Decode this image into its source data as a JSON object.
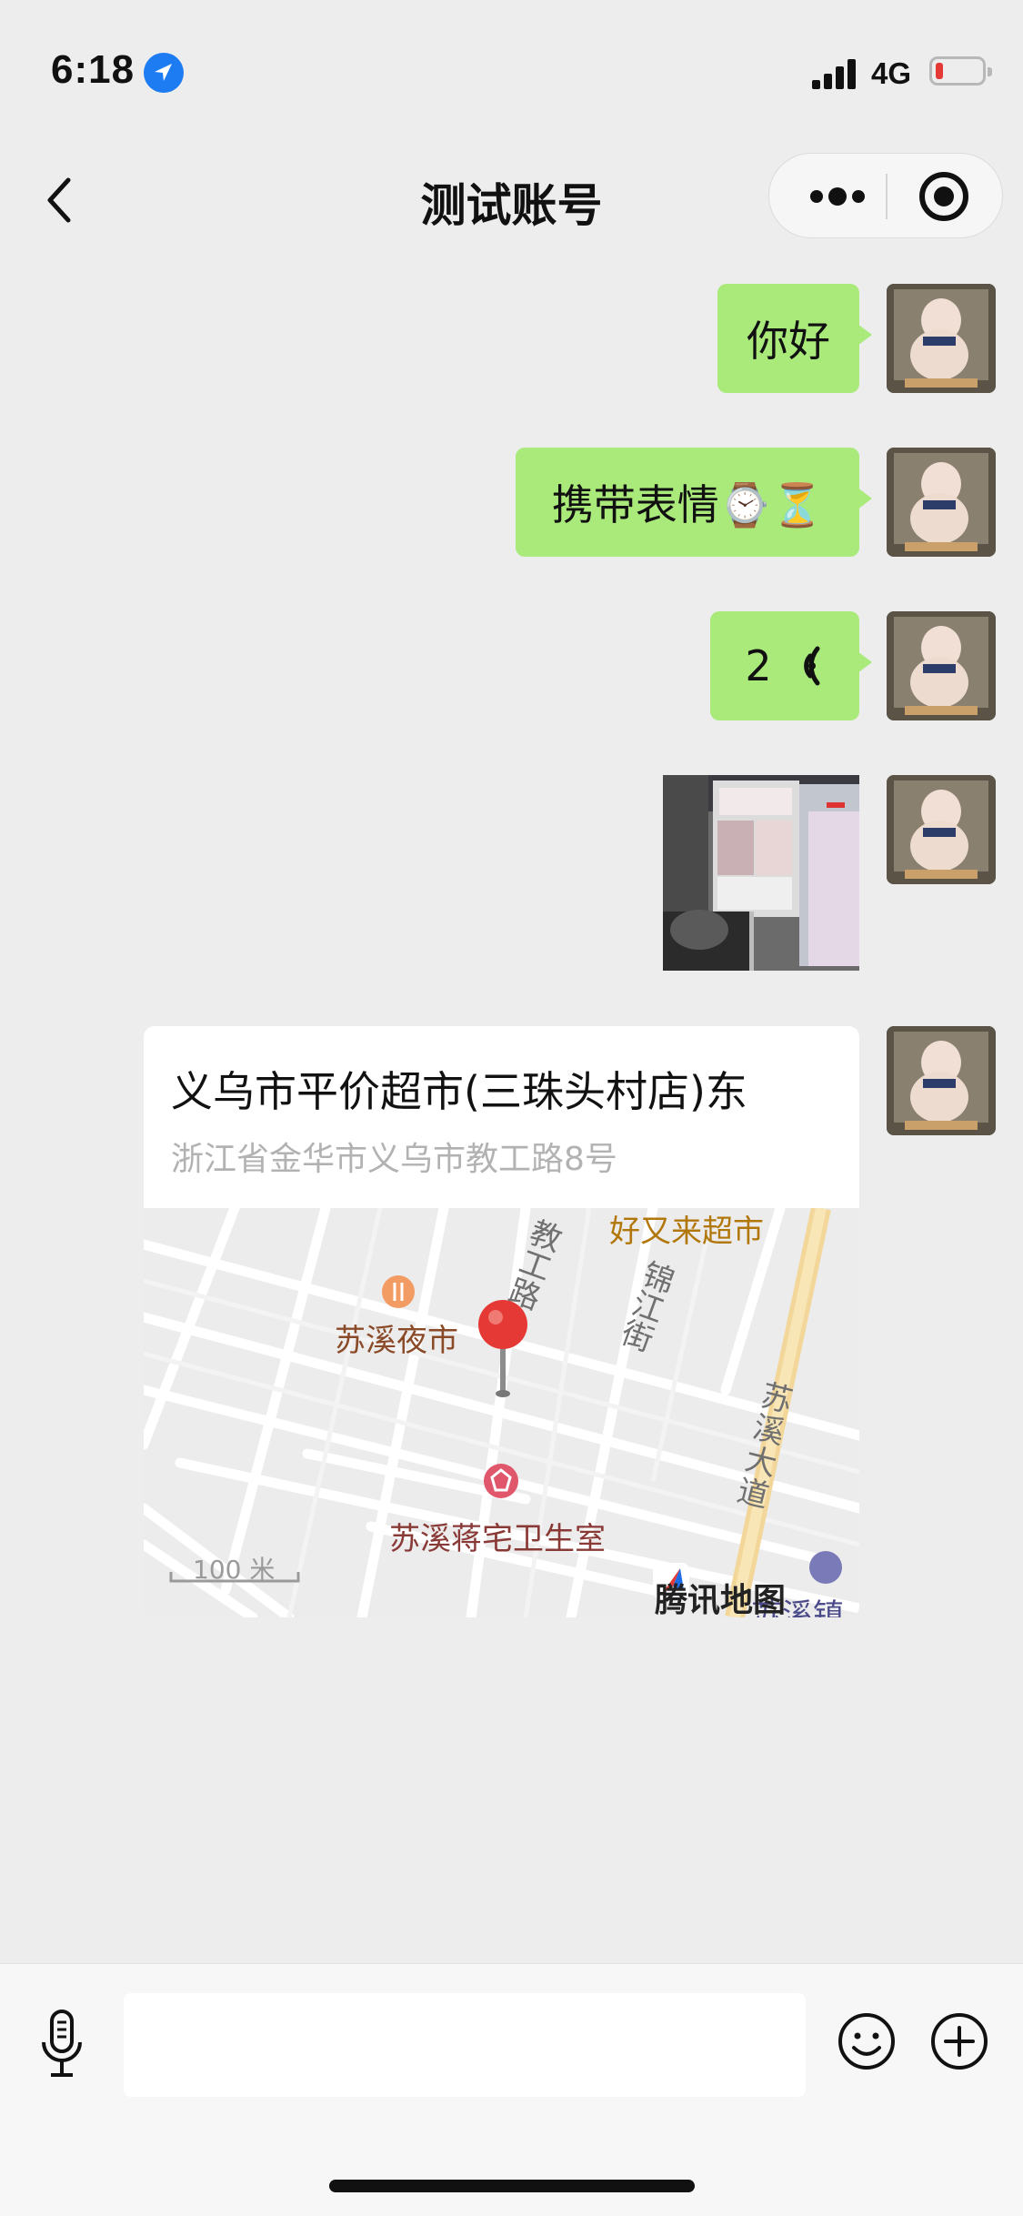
{
  "status_bar": {
    "time": "6:18",
    "network": "4G",
    "battery_level": 0.15
  },
  "nav": {
    "title": "测试账号"
  },
  "messages": [
    {
      "type": "text",
      "text": "你好"
    },
    {
      "type": "text",
      "text": "携带表情⌚⏳"
    },
    {
      "type": "voice",
      "duration": "2"
    },
    {
      "type": "image"
    },
    {
      "type": "location",
      "name": "义乌市平价超市(三珠头村店)东",
      "address": "浙江省金华市义乌市教工路8号",
      "map": {
        "labels": {
          "supermarket": "好又来超市",
          "road1": "教工路",
          "road2": "锦江街",
          "night_market": "苏溪夜市",
          "avenue": "苏溪大道",
          "clinic": "苏溪蒋宅卫生室",
          "town": "苏溪镇",
          "scale": "100 米",
          "brand": "腾讯地图"
        }
      }
    }
  ],
  "colors": {
    "bubble": "#a9ea7a",
    "background": "#ededed",
    "pin": "#e53935"
  },
  "icons": [
    "location-arrow-icon",
    "back-icon",
    "more-icon",
    "target-icon",
    "mic-icon",
    "emoji-icon",
    "plus-icon"
  ]
}
